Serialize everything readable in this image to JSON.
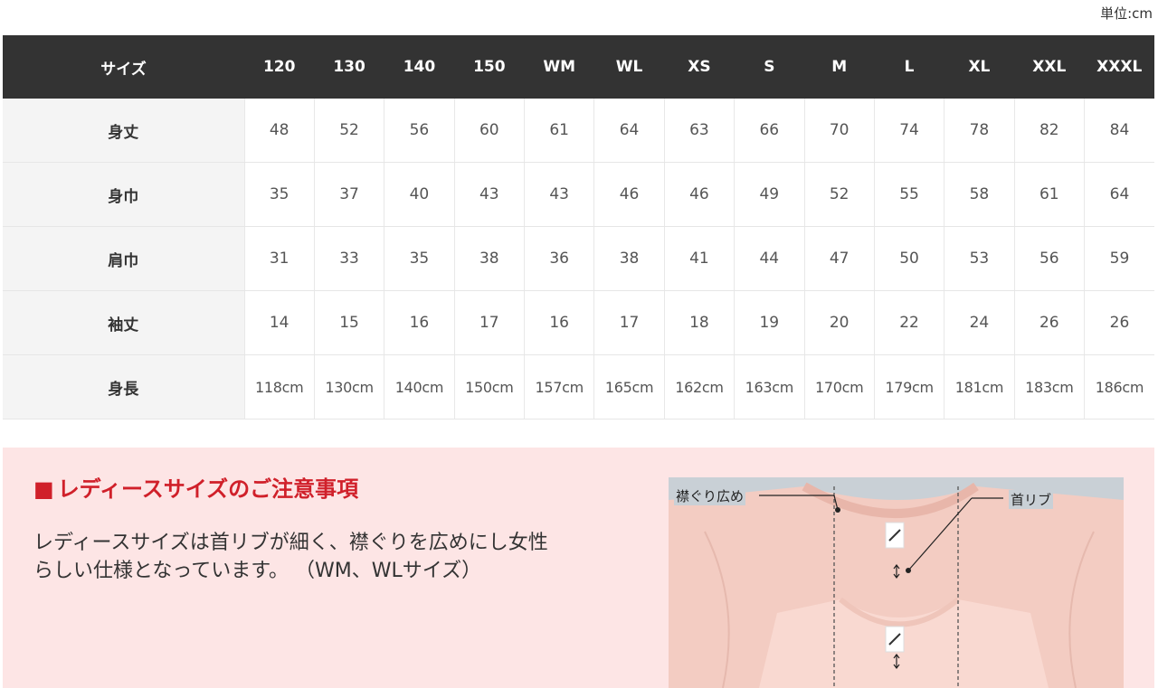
{
  "unit_label": "単位:cm",
  "size_table": {
    "corner": "サイズ",
    "sizes": [
      "120",
      "130",
      "140",
      "150",
      "WM",
      "WL",
      "XS",
      "S",
      "M",
      "L",
      "XL",
      "XXL",
      "XXXL"
    ],
    "rows": [
      {
        "label": "身丈",
        "values": [
          "48",
          "52",
          "56",
          "60",
          "61",
          "64",
          "63",
          "66",
          "70",
          "74",
          "78",
          "82",
          "84"
        ]
      },
      {
        "label": "身巾",
        "values": [
          "35",
          "37",
          "40",
          "43",
          "43",
          "46",
          "46",
          "49",
          "52",
          "55",
          "58",
          "61",
          "64"
        ]
      },
      {
        "label": "肩巾",
        "values": [
          "31",
          "33",
          "35",
          "38",
          "36",
          "38",
          "41",
          "44",
          "47",
          "50",
          "53",
          "56",
          "59"
        ]
      },
      {
        "label": "袖丈",
        "values": [
          "14",
          "15",
          "16",
          "17",
          "16",
          "17",
          "18",
          "19",
          "20",
          "22",
          "24",
          "26",
          "26"
        ]
      },
      {
        "label": "身長",
        "values": [
          "118cm",
          "130cm",
          "140cm",
          "150cm",
          "157cm",
          "165cm",
          "162cm",
          "163cm",
          "170cm",
          "179cm",
          "181cm",
          "183cm",
          "186cm"
        ]
      }
    ]
  },
  "notice": {
    "title": "レディースサイズのご注意事項",
    "title_mark": "■",
    "body_line1": "レディースサイズは首リブが細く、襟ぐりを広めにし女性",
    "body_line2": "らしい仕様となっています。 （WM、WLサイズ）"
  },
  "photo": {
    "label_collar": "襟ぐり広め",
    "label_rib": "首リブ"
  },
  "colors": {
    "header_bg": "#333333",
    "rowhead_bg": "#f4f4f4",
    "notice_bg": "#fde5e5",
    "notice_title": "#d0202a",
    "shirt_pink": "#f5cfc6"
  }
}
